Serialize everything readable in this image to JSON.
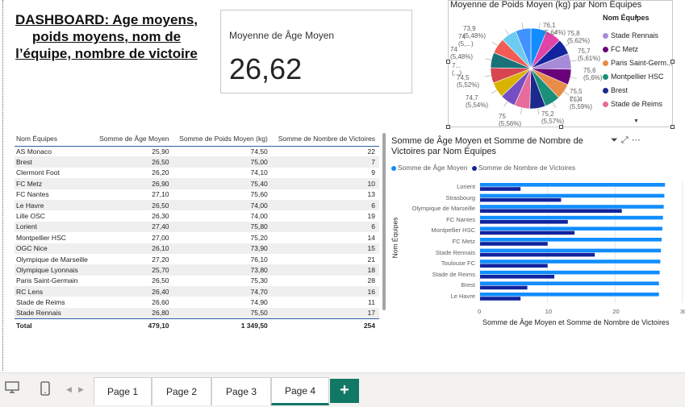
{
  "dashboard_title": "DASHBOARD: Age moyens, poids moyens, nom de l’équipe, nombre de victoire",
  "kpi_card": {
    "label": "Moyenne de Âge Moyen",
    "value": "26,62"
  },
  "pie_visual": {
    "title": "Moyenne de Poids Moyen (kg) par Nom Équipes",
    "legend_title": "Nom Équipes",
    "legend": [
      {
        "label": "Stade Rennais",
        "color": "#a78bd9"
      },
      {
        "label": "FC Metz",
        "color": "#6b007b"
      },
      {
        "label": "Paris Saint-Germ...",
        "color": "#e88d47"
      },
      {
        "label": "Montpellier HSC",
        "color": "#1a8f7a"
      },
      {
        "label": "Brest",
        "color": "#1b2a8a"
      },
      {
        "label": "Stade de Reims",
        "color": "#e66c9c"
      }
    ],
    "labels": [
      "76,1 (5,64%)",
      "75,8 (5,62%)",
      "75,7 (5,61%)",
      "75,6 (5,6%)",
      "75,5 (...)",
      "75,4 (5,59%)",
      "75,2 (5,57%)",
      "75 (5,56%)",
      "74,7 (5,54%)",
      "74,5 (5,52%)",
      "7... (...)",
      "74 (5,48%)",
      "74 (5,...)",
      "73,9 (5,48%)"
    ]
  },
  "table": {
    "columns": [
      "Nom Équipes",
      "Somme de Âge Moyen",
      "Somme de Poids Moyen (kg)",
      "Somme de Nombre de Victoires"
    ],
    "rows": [
      [
        "AS Monaco",
        "25,90",
        "74,50",
        "22"
      ],
      [
        "Brest",
        "26,50",
        "75,00",
        "7"
      ],
      [
        "Clermont Foot",
        "26,20",
        "74,10",
        "9"
      ],
      [
        "FC Metz",
        "26,90",
        "75,40",
        "10"
      ],
      [
        "FC Nantes",
        "27,10",
        "75,60",
        "13"
      ],
      [
        "Le Havre",
        "26,50",
        "74,00",
        "6"
      ],
      [
        "Lille OSC",
        "26,30",
        "74,00",
        "19"
      ],
      [
        "Lorient",
        "27,40",
        "75,80",
        "6"
      ],
      [
        "Montpellier HSC",
        "27,00",
        "75,20",
        "14"
      ],
      [
        "OGC Nice",
        "26,10",
        "73,90",
        "15"
      ],
      [
        "Olympique de Marseille",
        "27,20",
        "76,10",
        "21"
      ],
      [
        "Olympique Lyonnais",
        "25,70",
        "73,80",
        "18"
      ],
      [
        "Paris Saint-Germain",
        "26,50",
        "75,30",
        "28"
      ],
      [
        "RC Lens",
        "26,40",
        "74,70",
        "16"
      ],
      [
        "Stade de Reims",
        "26,60",
        "74,90",
        "11"
      ],
      [
        "Stade Rennais",
        "26,80",
        "75,50",
        "17"
      ]
    ],
    "total": [
      "Total",
      "479,10",
      "1 349,50",
      "254"
    ]
  },
  "bar_visual": {
    "title": "Somme de Âge Moyen et Somme de Nombre de Victoires par Nom Équipes",
    "legend": [
      "Somme de Âge Moyen",
      "Somme de Nombre de Victoires"
    ],
    "x_axis_title": "Somme de Âge Moyen et Somme de Nombre de Victoires",
    "y_axis_title": "Nom Équipes",
    "icons": [
      "filter-icon",
      "focus-mode-icon",
      "more-options-icon"
    ]
  },
  "chart_data": [
    {
      "type": "pie",
      "title": "Moyenne de Poids Moyen (kg) par Nom Équipes",
      "categories": [
        "Olympique de Marseille",
        "Lorient",
        "FC Nantes",
        "Stade Rennais",
        "FC Metz",
        "Paris Saint-Germain",
        "Montpellier HSC",
        "Brest",
        "Stade de Reims",
        "RC Lens",
        "AS Monaco",
        "Clermont Foot",
        "Le Havre",
        "Lille OSC",
        "OGC Nice",
        "Olympique Lyonnais"
      ],
      "values": [
        76.1,
        75.8,
        75.6,
        75.5,
        75.4,
        75.3,
        75.2,
        75.0,
        74.9,
        74.7,
        74.5,
        74.1,
        74.0,
        74.0,
        73.9,
        73.8
      ],
      "colors": [
        "#118dff",
        "#e044a7",
        "#12239e",
        "#a78bd9",
        "#6b007b",
        "#e88d47",
        "#1a8f7a",
        "#1b2a8a",
        "#e66c9c",
        "#744ec2",
        "#d9b300",
        "#d64550",
        "#197278",
        "#f25c54",
        "#6ccbf0",
        "#4092ff"
      ]
    },
    {
      "type": "bar",
      "orientation": "horizontal",
      "categories": [
        "Lorient",
        "Strasbourg",
        "Olympique de Marseille",
        "FC Nantes",
        "Montpellier HSC",
        "FC Metz",
        "Stade Rennais",
        "Toulouse FC",
        "Stade de Reims",
        "Brest",
        "Le Havre"
      ],
      "series": [
        {
          "name": "Somme de Âge Moyen",
          "color": "#118dff",
          "values": [
            27.4,
            27.3,
            27.2,
            27.1,
            27.0,
            26.9,
            26.8,
            26.7,
            26.6,
            26.5,
            26.5
          ]
        },
        {
          "name": "Somme de Nombre de Victoires",
          "color": "#12239e",
          "values": [
            6,
            12,
            21,
            13,
            14,
            10,
            17,
            10,
            11,
            7,
            6
          ]
        }
      ],
      "xlim": [
        0,
        30
      ],
      "x_ticks": [
        "0",
        "10",
        "20",
        "30"
      ],
      "xlabel": "Somme de Âge Moyen et Somme de Nombre de Victoires",
      "ylabel": "Nom Équipes"
    }
  ],
  "pages": [
    {
      "label": "Page 1",
      "active": false
    },
    {
      "label": "Page 2",
      "active": false
    },
    {
      "label": "Page 3",
      "active": false
    },
    {
      "label": "Page 4",
      "active": true
    }
  ],
  "add_page_label": "+"
}
